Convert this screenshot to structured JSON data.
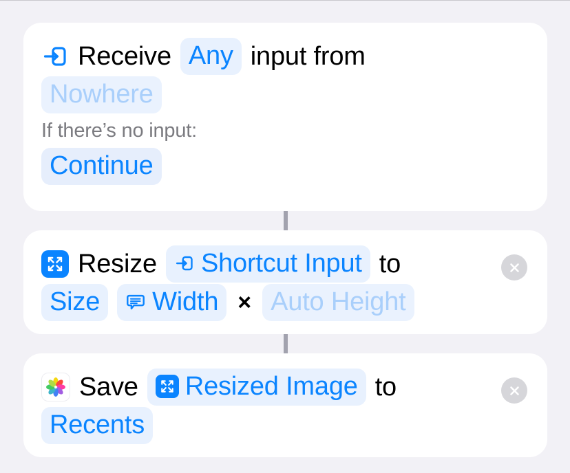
{
  "app": "Shortcuts",
  "accent_color": "#0a84ff",
  "background_color": "#f2f1f6",
  "card_color": "#ffffff",
  "pill_color": "#e8f1fe",
  "connector_color": "#a2a2ae",
  "actions": [
    {
      "id": "receive-input",
      "icon": "shortcut-input-icon",
      "line1": {
        "word_receive": "Receive",
        "pill_type": "Any",
        "word_input_from": "input from"
      },
      "line2": {
        "pill_source": "Nowhere"
      },
      "line3": {
        "label_no_input": "If there’s no input:"
      },
      "line4": {
        "pill_fallback": "Continue"
      },
      "has_close_button": false
    },
    {
      "id": "resize-image",
      "app_icon": "resize-app-icon",
      "line1": {
        "word_resize": "Resize",
        "pill_input_icon": "shortcut-input-icon",
        "pill_input": "Shortcut Input",
        "word_to": "to"
      },
      "line2": {
        "pill_size": "Size",
        "pill_width_icon": "ask-for-input-icon",
        "pill_width": "Width",
        "multiply_symbol": "×",
        "pill_height": "Auto Height"
      },
      "has_close_button": true,
      "close_label": "×"
    },
    {
      "id": "save-to-photos",
      "app_icon": "photos-app-icon",
      "line1": {
        "word_save": "Save",
        "pill_image_icon": "resize-app-icon",
        "pill_image": "Resized Image",
        "word_to": "to"
      },
      "line2": {
        "pill_album": "Recents"
      },
      "has_close_button": true,
      "close_label": "×"
    }
  ]
}
